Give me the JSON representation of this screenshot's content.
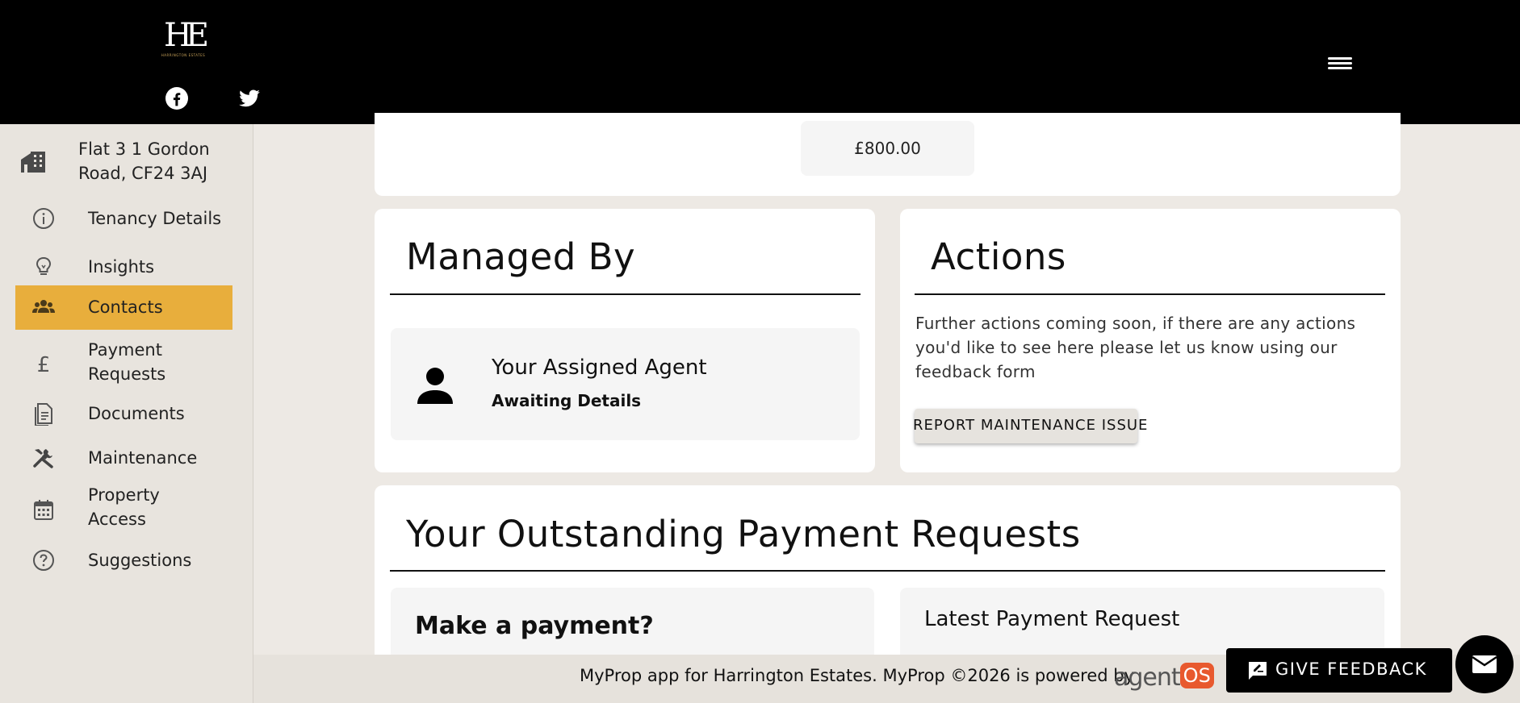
{
  "header": {
    "logo_mark": "HE",
    "logo_sub": "HARRINGTON ESTATES",
    "social": [
      "facebook-icon",
      "twitter-icon"
    ],
    "menu_icon": "hamburger-menu-icon"
  },
  "sidebar": {
    "address": "Flat 3 1 Gordon Road, CF24 3AJ",
    "address_icon": "building-icon",
    "active_color": "#e8ae3c",
    "items": [
      {
        "label": "Tenancy Details",
        "icon": "info-icon"
      },
      {
        "label": "Insights",
        "icon": "lightbulb-icon"
      },
      {
        "label": "Contacts",
        "icon": "people-icon",
        "active": true
      },
      {
        "label": "Payment Requests",
        "icon": "pound-icon"
      },
      {
        "label": "Documents",
        "icon": "document-icon"
      },
      {
        "label": "Maintenance",
        "icon": "tools-icon"
      },
      {
        "label": "Property Access",
        "icon": "calendar-icon"
      },
      {
        "label": "Suggestions",
        "icon": "question-icon"
      }
    ]
  },
  "main": {
    "price": "£800.00",
    "managed_by": {
      "title": "Managed By",
      "agent_title": "Your Assigned Agent",
      "agent_status": "Awaiting Details"
    },
    "actions": {
      "title": "Actions",
      "text": "Further actions coming soon, if there are any actions you'd like to see here please let us know using our feedback form",
      "report_button": "REPORT MAINTENANCE ISSUE"
    },
    "payments": {
      "title": "Your Outstanding Payment Requests",
      "make_payment": "Make a payment?",
      "latest": "Latest Payment Request"
    }
  },
  "footer": {
    "text": "MyProp app for Harrington Estates. MyProp ©2026 is powered by",
    "brand_a": "agent",
    "brand_os": "OS",
    "brand_color": "#e8592e"
  },
  "feedback": {
    "label": "GIVE FEEDBACK"
  }
}
